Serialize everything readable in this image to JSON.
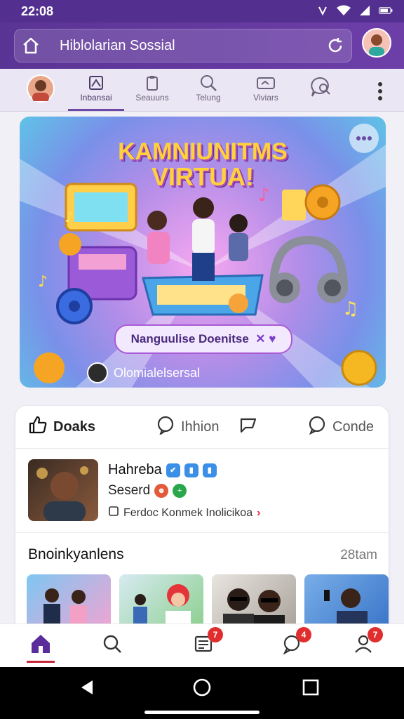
{
  "status": {
    "time": "22:08"
  },
  "topbar": {
    "title": "Hiblolarian Sossial"
  },
  "tabs": [
    {
      "label": "Inbansai",
      "icon": "image-icon"
    },
    {
      "label": "Seauuns",
      "icon": "clipboard-icon"
    },
    {
      "label": "Telung",
      "icon": "search-icon"
    },
    {
      "label": "Viviars",
      "icon": "video-icon"
    },
    {
      "label": "",
      "icon": "chat-search-icon"
    }
  ],
  "banner": {
    "title_line1": "KAMNIUNITMS",
    "title_line2": "VIRTUA!",
    "pill": "Nanguulise Doenitse",
    "user": "Olomialelsersal"
  },
  "actions": {
    "like": "Doaks",
    "comment": "Ihhion",
    "share": "Conde"
  },
  "post": {
    "name": "Hahreba",
    "sub": "Seserd",
    "meta": "Ferdoc  Konmek Inolicikoa"
  },
  "section": {
    "title": "Bnoinkyanlens",
    "meta": "28tam"
  },
  "bottomnav": {
    "badge_feed": "7",
    "badge_chat": "4",
    "badge_profile": "7"
  },
  "colors": {
    "accent": "#5a3495",
    "badge": "#e02e2e"
  }
}
